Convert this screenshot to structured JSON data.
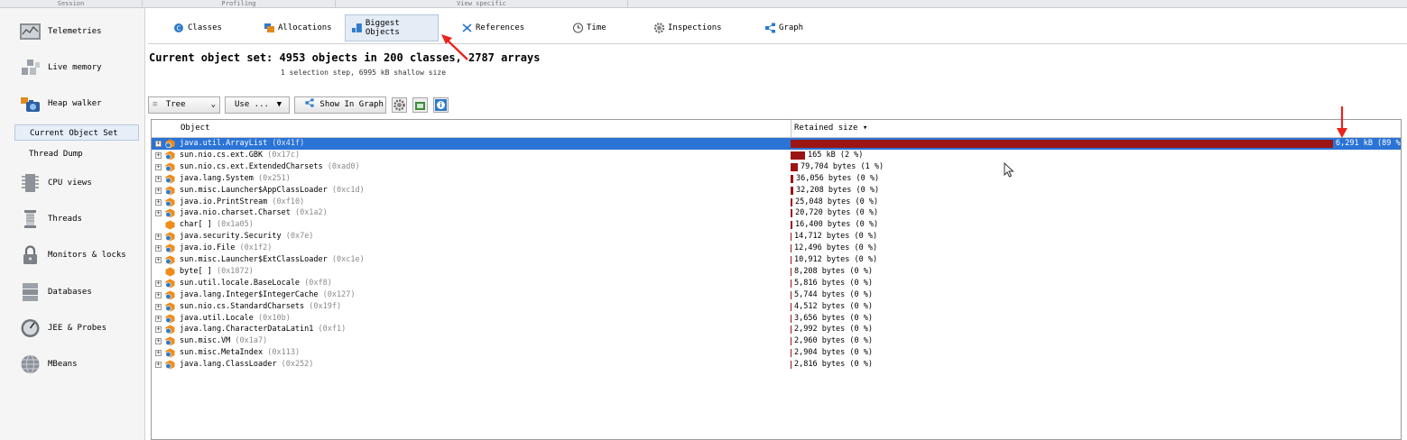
{
  "topbar": {
    "segments": [
      "Session",
      "Profiling",
      "View specific"
    ]
  },
  "sidebar": {
    "items": [
      {
        "label": "Telemetries",
        "icon": "telemetries-icon"
      },
      {
        "label": "Live memory",
        "icon": "live-memory-icon"
      },
      {
        "label": "Heap walker",
        "icon": "heap-walker-icon"
      },
      {
        "label": "CPU views",
        "icon": "cpu-views-icon"
      },
      {
        "label": "Threads",
        "icon": "threads-icon"
      },
      {
        "label": "Monitors & locks",
        "icon": "lock-icon"
      },
      {
        "label": "Databases",
        "icon": "database-icon"
      },
      {
        "label": "JEE & Probes",
        "icon": "probe-gauge-icon"
      },
      {
        "label": "MBeans",
        "icon": "globe-icon"
      }
    ],
    "subitems": [
      "Current Object Set",
      "Thread Dump"
    ]
  },
  "tabs": [
    {
      "label": "Classes",
      "icon": "class-icon",
      "color": "#2f7bc9"
    },
    {
      "label": "Allocations",
      "icon": "allocations-icon",
      "color": "#e08a1e"
    },
    {
      "label": "Biggest Objects",
      "icon": "biggest-objects-icon",
      "color": "#2f7bc9"
    },
    {
      "label": "References",
      "icon": "references-icon",
      "color": "#2f7bc9"
    },
    {
      "label": "Time",
      "icon": "clock-icon",
      "color": "#555555"
    },
    {
      "label": "Inspections",
      "icon": "gear-icon",
      "color": "#666666"
    },
    {
      "label": "Graph",
      "icon": "graph-icon",
      "color": "#2f7bc9"
    }
  ],
  "main": {
    "heading": "Current object set: 4953 objects in 200 classes, 2787 arrays",
    "subheading": "1 selection step, 6995 kB shallow size"
  },
  "toolbar": {
    "view_select": "Tree",
    "use_button": "Use ...",
    "show_in_graph": "Show In Graph"
  },
  "table": {
    "headers": {
      "object": "Object",
      "retained": "Retained size ▾"
    },
    "rows": [
      {
        "name": "java.util.ArrayList",
        "addr": "(0x41f)",
        "size": "6,291 kB (89 %)",
        "fraction": 0.89,
        "kind": "class",
        "selected": true
      },
      {
        "name": "sun.nio.cs.ext.GBK",
        "addr": "(0x17c)",
        "size": "165 kB (2 %)",
        "fraction": 0.0234,
        "kind": "class"
      },
      {
        "name": "sun.nio.cs.ext.ExtendedCharsets",
        "addr": "(0xad0)",
        "size": "79,704 bytes (1 %)",
        "fraction": 0.0113,
        "kind": "class"
      },
      {
        "name": "java.lang.System",
        "addr": "(0x251)",
        "size": "36,056 bytes (0 %)",
        "fraction": 0.0051,
        "kind": "class"
      },
      {
        "name": "sun.misc.Launcher$AppClassLoader",
        "addr": "(0xc1d)",
        "size": "32,208 bytes (0 %)",
        "fraction": 0.0046,
        "kind": "class"
      },
      {
        "name": "java.io.PrintStream",
        "addr": "(0xf10)",
        "size": "25,048 bytes (0 %)",
        "fraction": 0.0036,
        "kind": "class"
      },
      {
        "name": "java.nio.charset.Charset",
        "addr": "(0x1a2)",
        "size": "20,720 bytes (0 %)",
        "fraction": 0.0029,
        "kind": "class"
      },
      {
        "name": "char[ ]",
        "addr": "(0x1a05)",
        "size": "16,400 bytes (0 %)",
        "fraction": 0.0023,
        "kind": "array"
      },
      {
        "name": "java.security.Security",
        "addr": "(0x7e)",
        "size": "14,712 bytes (0 %)",
        "fraction": 0.0021,
        "kind": "class"
      },
      {
        "name": "java.io.File",
        "addr": "(0x1f2)",
        "size": "12,496 bytes (0 %)",
        "fraction": 0.0018,
        "kind": "class"
      },
      {
        "name": "sun.misc.Launcher$ExtClassLoader",
        "addr": "(0xc1e)",
        "size": "10,912 bytes (0 %)",
        "fraction": 0.0015,
        "kind": "class"
      },
      {
        "name": "byte[ ]",
        "addr": "(0x1872)",
        "size": "8,208 bytes (0 %)",
        "fraction": 0.0012,
        "kind": "array"
      },
      {
        "name": "sun.util.locale.BaseLocale",
        "addr": "(0xf8)",
        "size": "5,816 bytes (0 %)",
        "fraction": 0.0008,
        "kind": "class"
      },
      {
        "name": "java.lang.Integer$IntegerCache",
        "addr": "(0x127)",
        "size": "5,744 bytes (0 %)",
        "fraction": 0.0008,
        "kind": "class"
      },
      {
        "name": "sun.nio.cs.StandardCharsets",
        "addr": "(0x19f)",
        "size": "4,512 bytes (0 %)",
        "fraction": 0.0006,
        "kind": "class"
      },
      {
        "name": "java.util.Locale",
        "addr": "(0x10b)",
        "size": "3,656 bytes (0 %)",
        "fraction": 0.0005,
        "kind": "class"
      },
      {
        "name": "java.lang.CharacterDataLatin1",
        "addr": "(0xf1)",
        "size": "2,992 bytes (0 %)",
        "fraction": 0.0004,
        "kind": "class"
      },
      {
        "name": "sun.misc.VM",
        "addr": "(0x1a7)",
        "size": "2,960 bytes (0 %)",
        "fraction": 0.0004,
        "kind": "class"
      },
      {
        "name": "sun.misc.MetaIndex",
        "addr": "(0x113)",
        "size": "2,904 bytes (0 %)",
        "fraction": 0.0004,
        "kind": "class"
      },
      {
        "name": "java.lang.ClassLoader",
        "addr": "(0x252)",
        "size": "2,816 bytes (0 %)",
        "fraction": 0.0004,
        "kind": "class"
      }
    ]
  },
  "colors": {
    "bar": "#9c1515",
    "selection": "#2b74d6",
    "annotation": "#e8241c"
  }
}
